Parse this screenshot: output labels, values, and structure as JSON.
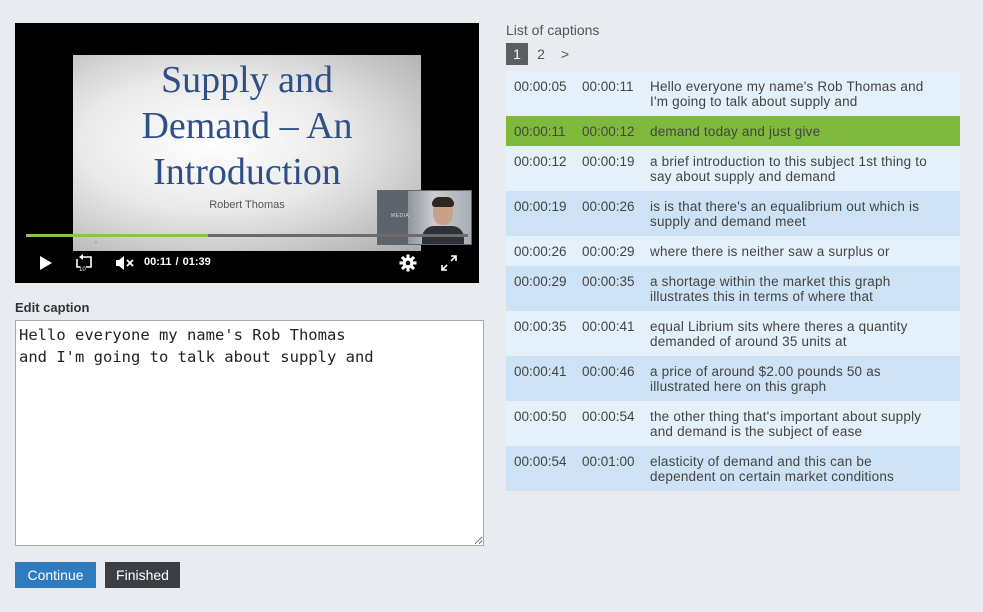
{
  "video": {
    "slide_title_lines": [
      "Supply and",
      "Demand – An",
      "Introduction"
    ],
    "slide_author": "Robert Thomas",
    "pip_label": "MEDIA",
    "current_time": "00:11",
    "time_separator": "/",
    "duration": "01:39",
    "progress_fraction": 0.11,
    "accent_color": "#8bc34a",
    "icons": [
      "play-icon",
      "rewind-10-icon",
      "mute-icon",
      "gear-icon",
      "fullscreen-icon"
    ]
  },
  "editor": {
    "label": "Edit caption",
    "value": "Hello everyone my name's Rob Thomas\nand I'm going to talk about supply and"
  },
  "buttons": {
    "continue": "Continue",
    "finished": "Finished",
    "continue_color": "#2e7bbf",
    "finished_color": "#3b3f44"
  },
  "captions": {
    "title": "List of captions",
    "pages": [
      "1",
      "2",
      ">"
    ],
    "active_page": "1",
    "active_row_color": "#7fba3c",
    "rows": [
      {
        "start": "00:00:05",
        "end": "00:00:11",
        "text": "Hello everyone my name's Rob Thomas and I'm going to talk about supply and"
      },
      {
        "start": "00:00:11",
        "end": "00:00:12",
        "text": "demand today and just give"
      },
      {
        "start": "00:00:12",
        "end": "00:00:19",
        "text": "a brief introduction to this subject 1st thing to say about supply and demand"
      },
      {
        "start": "00:00:19",
        "end": "00:00:26",
        "text": "is is that there's an equalibrium out which is supply and demand meet"
      },
      {
        "start": "00:00:26",
        "end": "00:00:29",
        "text": "where there is neither saw a surplus or"
      },
      {
        "start": "00:00:29",
        "end": "00:00:35",
        "text": "a shortage within the market this graph illustrates this in terms of where that"
      },
      {
        "start": "00:00:35",
        "end": "00:00:41",
        "text": "equal Librium sits where theres a quantity demanded of around 35 units at"
      },
      {
        "start": "00:00:41",
        "end": "00:00:46",
        "text": "a price of around $2.00 pounds 50 as illustrated here on this graph"
      },
      {
        "start": "00:00:50",
        "end": "00:00:54",
        "text": "the other thing that's important about supply and demand is the subject of ease"
      },
      {
        "start": "00:00:54",
        "end": "00:01:00",
        "text": "elasticity of demand and this can be dependent on certain market conditions"
      }
    ]
  }
}
